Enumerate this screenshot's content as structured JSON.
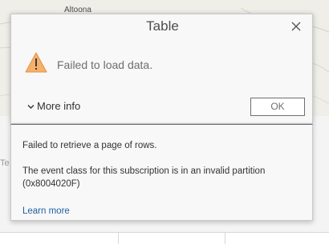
{
  "background": {
    "map_label": "Altoona",
    "table_tab_label": "Te"
  },
  "dialog": {
    "title": "Table",
    "close_icon": "close-icon",
    "warning_icon": "warning-triangle-icon",
    "message": "Failed to load data.",
    "more_info_label": "More info",
    "ok_label": "OK",
    "details": {
      "line1": "Failed to retrieve a page of rows.",
      "line2": "The event class for this subscription is in an invalid partition (0x8004020F)",
      "learn_more": "Learn more"
    }
  },
  "colors": {
    "warning_fill": "#f5b06a",
    "link": "#1f5f9e"
  }
}
